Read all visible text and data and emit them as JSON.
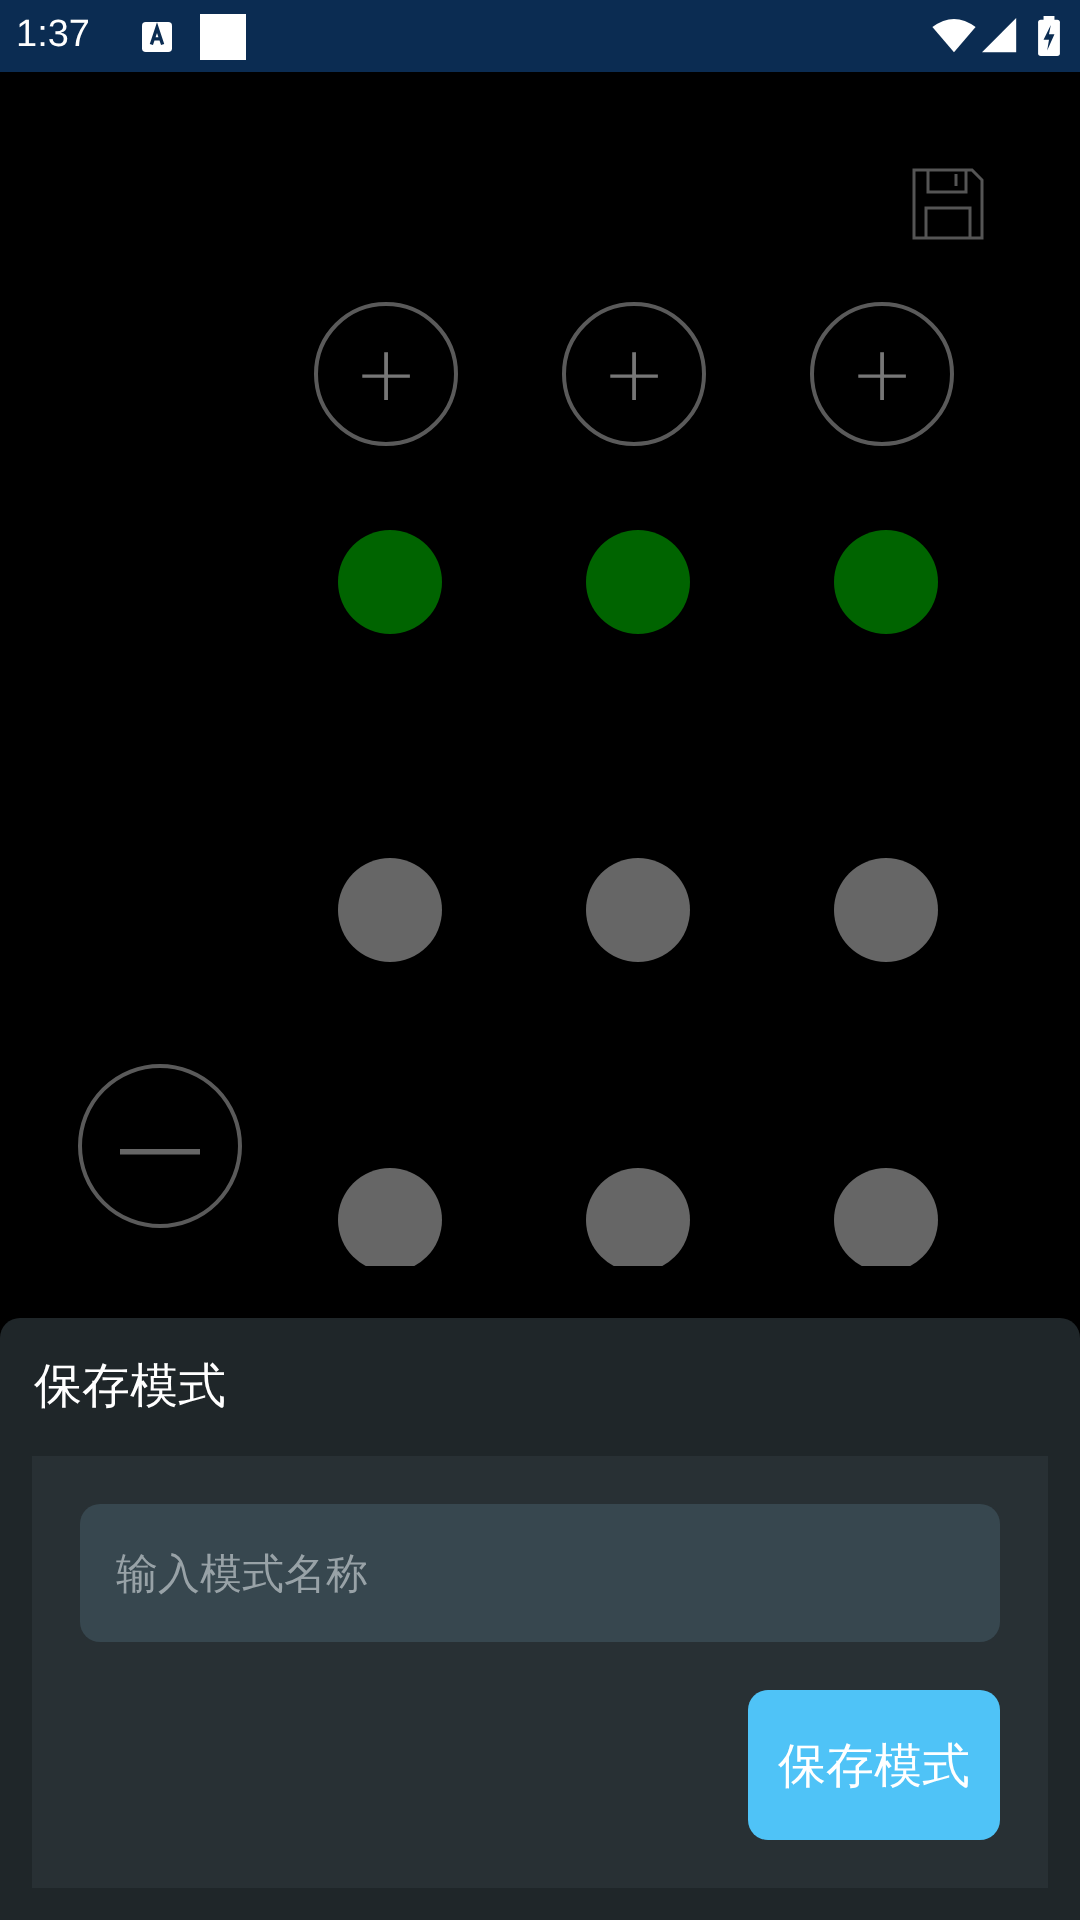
{
  "status_bar": {
    "time": "1:37"
  },
  "plus_buttons": [
    {
      "label": "+"
    },
    {
      "label": "+"
    },
    {
      "label": "+"
    }
  ],
  "dot_rows": [
    {
      "dots": [
        {
          "on": true
        },
        {
          "on": true
        },
        {
          "on": true
        }
      ]
    },
    {
      "dots": [
        {
          "on": false
        },
        {
          "on": false
        },
        {
          "on": false
        }
      ]
    },
    {
      "dots": [
        {
          "on": false
        },
        {
          "on": false
        },
        {
          "on": false
        }
      ]
    }
  ],
  "minus_button": {
    "label": "—"
  },
  "sheet": {
    "title": "保存模式",
    "name_field": {
      "placeholder": "输入模式名称"
    },
    "save_button": "保存模式"
  }
}
